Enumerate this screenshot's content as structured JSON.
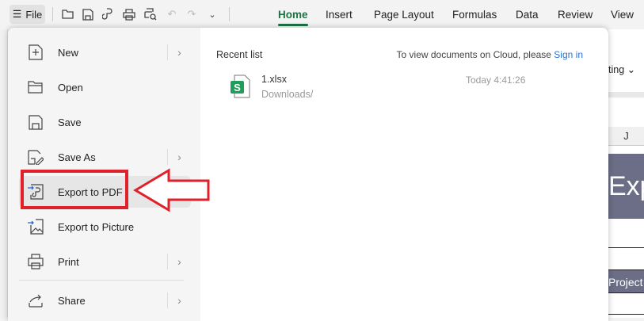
{
  "toolbar": {
    "file_label": "File",
    "tabs": [
      "Home",
      "Insert",
      "Page Layout",
      "Formulas",
      "Data",
      "Review",
      "View"
    ],
    "active_tab": "Home"
  },
  "menu": {
    "items": [
      {
        "label": "New",
        "icon": "new-file-icon",
        "submenu": true
      },
      {
        "label": "Open",
        "icon": "folder-icon",
        "submenu": false
      },
      {
        "label": "Save",
        "icon": "save-icon",
        "submenu": false
      },
      {
        "label": "Save As",
        "icon": "save-as-icon",
        "submenu": true
      },
      {
        "label": "Export to PDF",
        "icon": "export-pdf-icon",
        "submenu": false
      },
      {
        "label": "Export to Picture",
        "icon": "export-picture-icon",
        "submenu": false
      },
      {
        "label": "Print",
        "icon": "print-icon",
        "submenu": true
      },
      {
        "label": "Share",
        "icon": "share-icon",
        "submenu": true
      }
    ]
  },
  "recent": {
    "title": "Recent list",
    "cloud_text": "To view documents on Cloud, please ",
    "sign_in": "Sign in",
    "files": [
      {
        "name": "1.xlsx",
        "path": "Downloads/",
        "time": "Today 4:41:26",
        "badge": "S"
      }
    ]
  },
  "background": {
    "ribbon_text": "ting",
    "column": "J",
    "banner": "Exp",
    "cell": "Project"
  },
  "colors": {
    "accent": "#1e7145",
    "highlight": "#e0202a",
    "link": "#2a74d6"
  }
}
